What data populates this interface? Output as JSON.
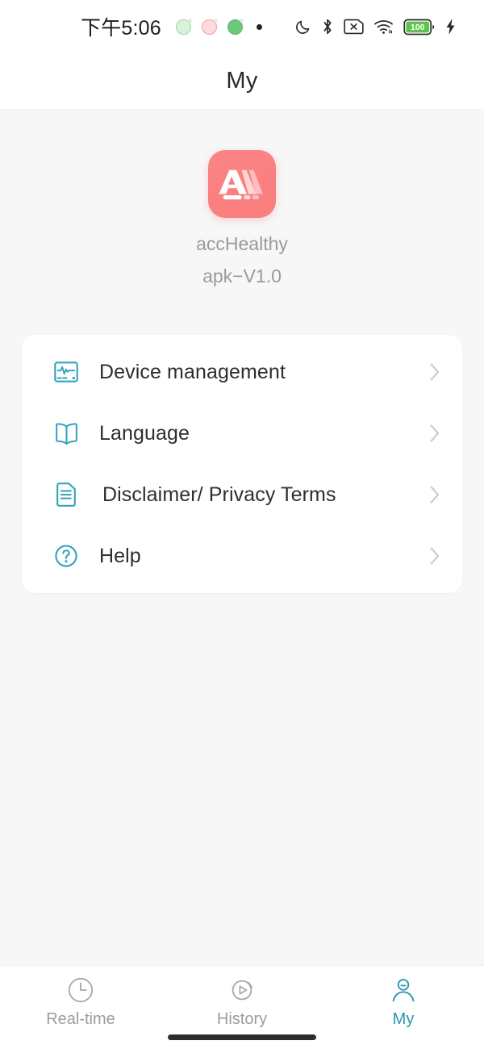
{
  "colors": {
    "accent_teal": "#2a96ae",
    "icon_teal": "#33a3bb",
    "app_icon_bg": "#f97d7d",
    "page_bg": "#f7f7f7",
    "card_bg": "#ffffff",
    "muted_text": "#9a9a9a",
    "primary_text": "#2e2e2e",
    "battery_green": "#5ec24b"
  },
  "status_bar": {
    "time": "下午5:06",
    "notification_icons": [
      "app-badge-green",
      "app-badge-pink",
      "app-badge-green-filled",
      "notification-dot"
    ],
    "right_icons": [
      "do-not-disturb-moon-icon",
      "bluetooth-icon",
      "no-sim-card-icon",
      "wifi-icon",
      "battery-icon",
      "charging-bolt-icon"
    ],
    "battery_level": "100"
  },
  "header": {
    "title": "My"
  },
  "app_info": {
    "icon_name": "acchealthy-app-logo",
    "name": "accHealthy",
    "version": "apk−V1.0"
  },
  "menu": {
    "items": [
      {
        "id": "device-management",
        "label": "Device management",
        "icon": "monitor-ecg-icon",
        "chevron": "chevron-right-icon"
      },
      {
        "id": "language",
        "label": "Language",
        "icon": "open-book-icon",
        "chevron": "chevron-right-icon"
      },
      {
        "id": "disclaimer-privacy-terms",
        "label": "Disclaimer/ Privacy Terms",
        "icon": "document-lines-icon",
        "chevron": "chevron-right-icon"
      },
      {
        "id": "help",
        "label": "Help",
        "icon": "question-circle-icon",
        "chevron": "chevron-right-icon"
      }
    ]
  },
  "bottom_nav": {
    "items": [
      {
        "id": "real-time",
        "label": "Real-time",
        "icon": "clock-icon",
        "active": false
      },
      {
        "id": "history",
        "label": "History",
        "icon": "play-circle-icon",
        "active": false
      },
      {
        "id": "my",
        "label": "My",
        "icon": "person-icon",
        "active": true
      }
    ]
  }
}
